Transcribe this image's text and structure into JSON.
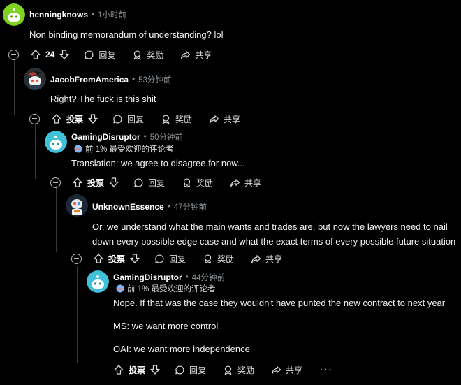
{
  "comments": [
    {
      "username": "henningknows",
      "time": "1小时前",
      "flair": "",
      "lines": [
        "Non binding memorandum of understanding? lol"
      ],
      "vote": "24",
      "actions": {
        "reply": "回复",
        "award": "奖励",
        "share": "共享"
      }
    },
    {
      "username": "JacobFromAmerica",
      "time": "53分钟前",
      "flair": "",
      "lines": [
        "Right? The fuck is this shit"
      ],
      "vote": "投票",
      "actions": {
        "reply": "回复",
        "award": "奖励",
        "share": "共享"
      }
    },
    {
      "username": "GamingDisruptor",
      "time": "50分钟前",
      "flair": "前 1% 最受欢迎的评论者",
      "lines": [
        "Translation: we agree to disagree for now..."
      ],
      "vote": "投票",
      "actions": {
        "reply": "回复",
        "award": "奖励",
        "share": "共享"
      }
    },
    {
      "username": "UnknownEssence",
      "time": "47分钟前",
      "flair": "",
      "lines": [
        "Or, we understand what the main wants and trades are, but now the lawyers need to nail",
        "down every possible edge case and what the exact terms of every possible future situation"
      ],
      "vote": "投票",
      "actions": {
        "reply": "回复",
        "award": "奖励",
        "share": "共享"
      }
    },
    {
      "username": "GamingDisruptor",
      "time": "44分钟前",
      "flair": "前 1% 最受欢迎的评论者",
      "lines": [
        "Nope. If that was the case they wouldn't have punted the new contract to next year",
        "MS: we want more control",
        "OAI: we want more independence"
      ],
      "vote": "投票",
      "actions": {
        "reply": "回复",
        "award": "奖励",
        "share": "共享"
      }
    }
  ],
  "separator": "•",
  "icons": [
    "snoo-avatar",
    "collapse-icon",
    "upvote-icon",
    "downvote-icon",
    "reply-icon",
    "award-icon",
    "share-icon",
    "more-options-icon",
    "flair-icon"
  ]
}
